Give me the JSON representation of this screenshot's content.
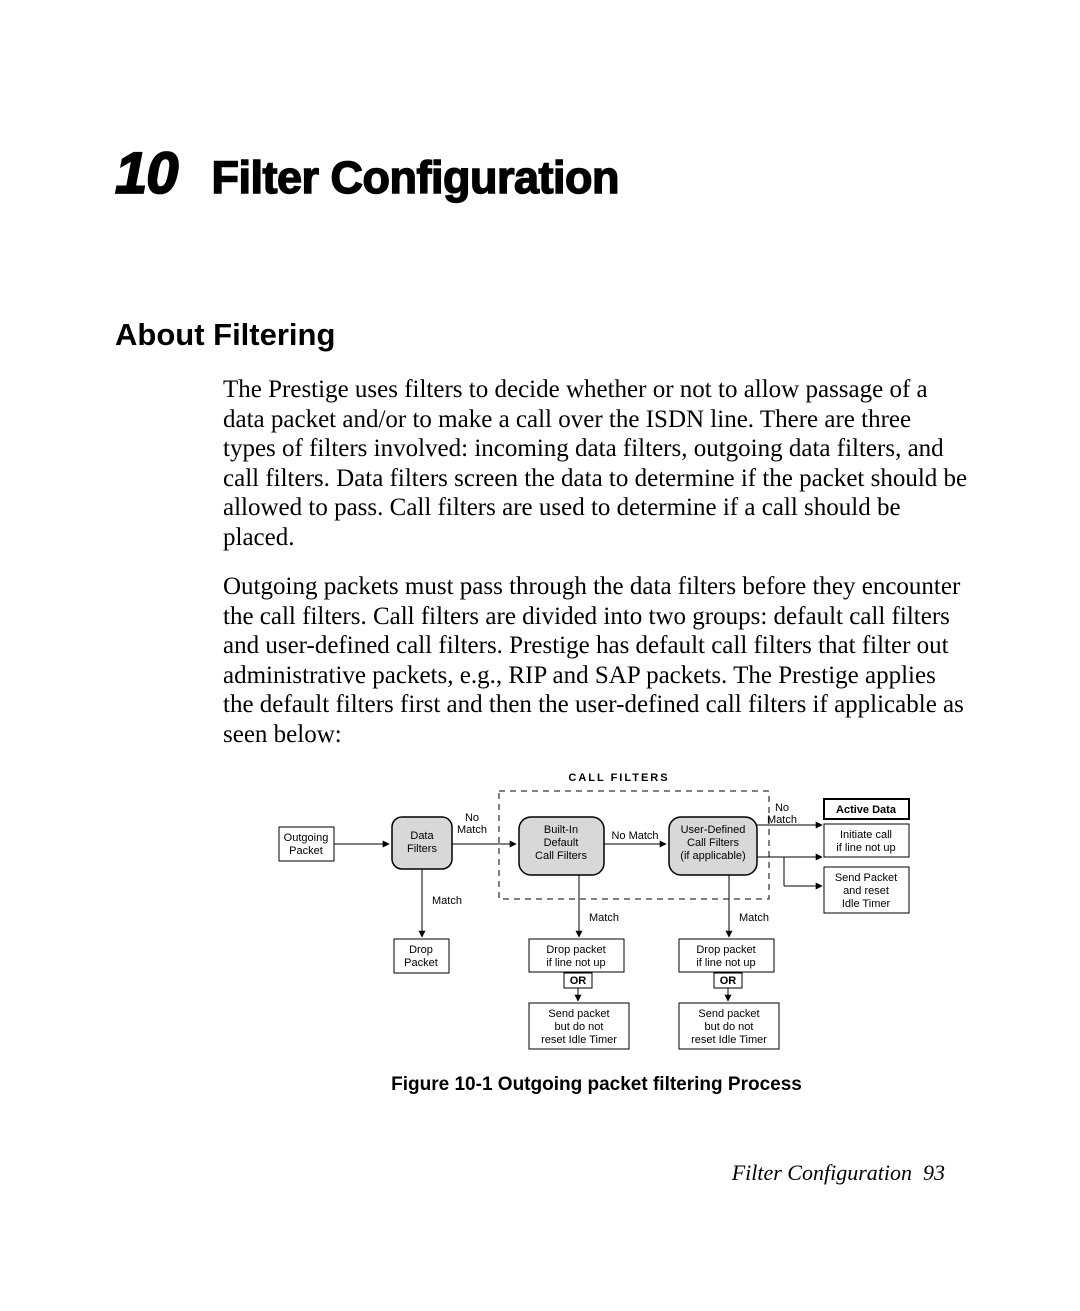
{
  "chapter": {
    "number": "10",
    "title": "Filter Configuration"
  },
  "section": {
    "heading": "About Filtering"
  },
  "paragraphs": {
    "p1": "The Prestige uses filters to decide whether or not to allow passage of a data packet and/or to make a call over the ISDN line. There are three types of filters involved: incoming data filters, outgoing data filters, and call filters. Data filters screen the data to determine if the packet should be allowed to pass. Call filters are used to determine if a call should be placed.",
    "p2": "Outgoing packets must pass through the data filters before they encounter the call filters. Call filters are divided into two groups: default call filters and user-defined call filters. Prestige has default call filters that filter out administrative packets, e.g., RIP and SAP packets. The Prestige applies the default filters first and then the user-defined call filters if applicable as seen below:"
  },
  "figure": {
    "caption": "Figure 10-1 Outgoing packet filtering Process",
    "labels": {
      "call_filters_title": "CALL FILTERS",
      "outgoing_packet": "Outgoing\nPacket",
      "data_filters": "Data\nFilters",
      "builtin": "Built-In\nDefault\nCall Filters",
      "user_defined": "User-Defined\nCall Filters\n(if applicable)",
      "active_data": "Active Data",
      "no_match": "No\nMatch",
      "no_match_mid": "No Match",
      "match": "Match",
      "drop_packet": "Drop\nPacket",
      "drop_if": "Drop packet\nif line not up",
      "or": "OR",
      "send_no_reset": "Send packet\nbut do not\nreset Idle Timer",
      "initiate": "Initiate call\nif line not up",
      "send_reset": "Send Packet\nand reset\nIdle Timer"
    }
  },
  "footer": {
    "label": "Filter Configuration",
    "page": "93"
  }
}
